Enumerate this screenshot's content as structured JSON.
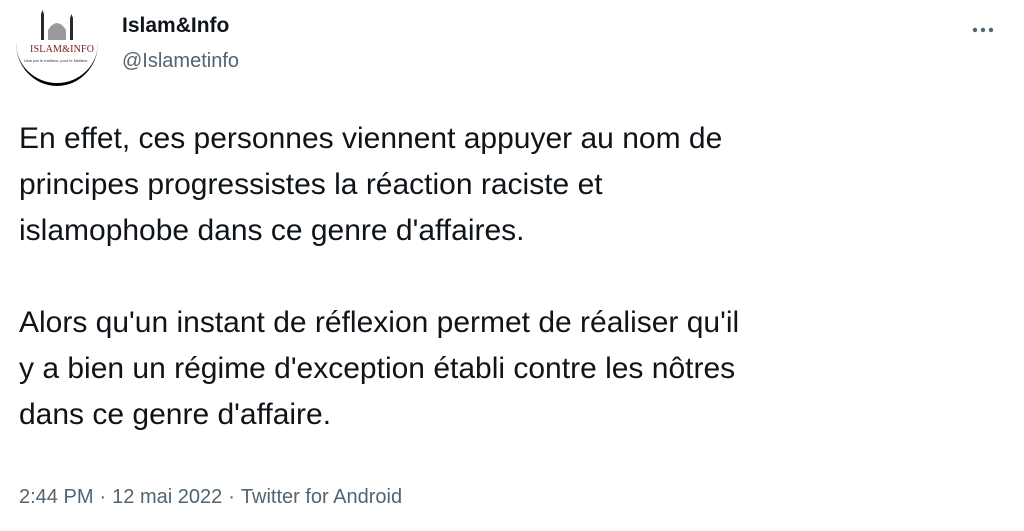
{
  "author": {
    "display_name": "Islam&Info",
    "handle": "@Islametinfo",
    "avatar_logo": "ISLAM&INFO",
    "avatar_tagline": "Unis par le meilleur, pour le Meilleur"
  },
  "tweet": {
    "paragraphs": [
      "En effet, ces personnes viennent appuyer au nom de\nprincipes progressistes la réaction raciste et\nislamophobe dans ce genre d'affaires.",
      "Alors qu'un instant de réflexion permet de réaliser qu'il\ny a bien un régime d'exception établi contre les nôtres\ndans ce genre d'affaire."
    ]
  },
  "meta": {
    "time": "2:44 PM",
    "separator": "·",
    "date": "12 mai 2022",
    "source": "Twitter for Android"
  },
  "icons": {
    "more": "more-horizontal-icon"
  },
  "colors": {
    "text_primary": "#0f1419",
    "text_secondary": "#536471",
    "logo_red": "#7a1616"
  }
}
